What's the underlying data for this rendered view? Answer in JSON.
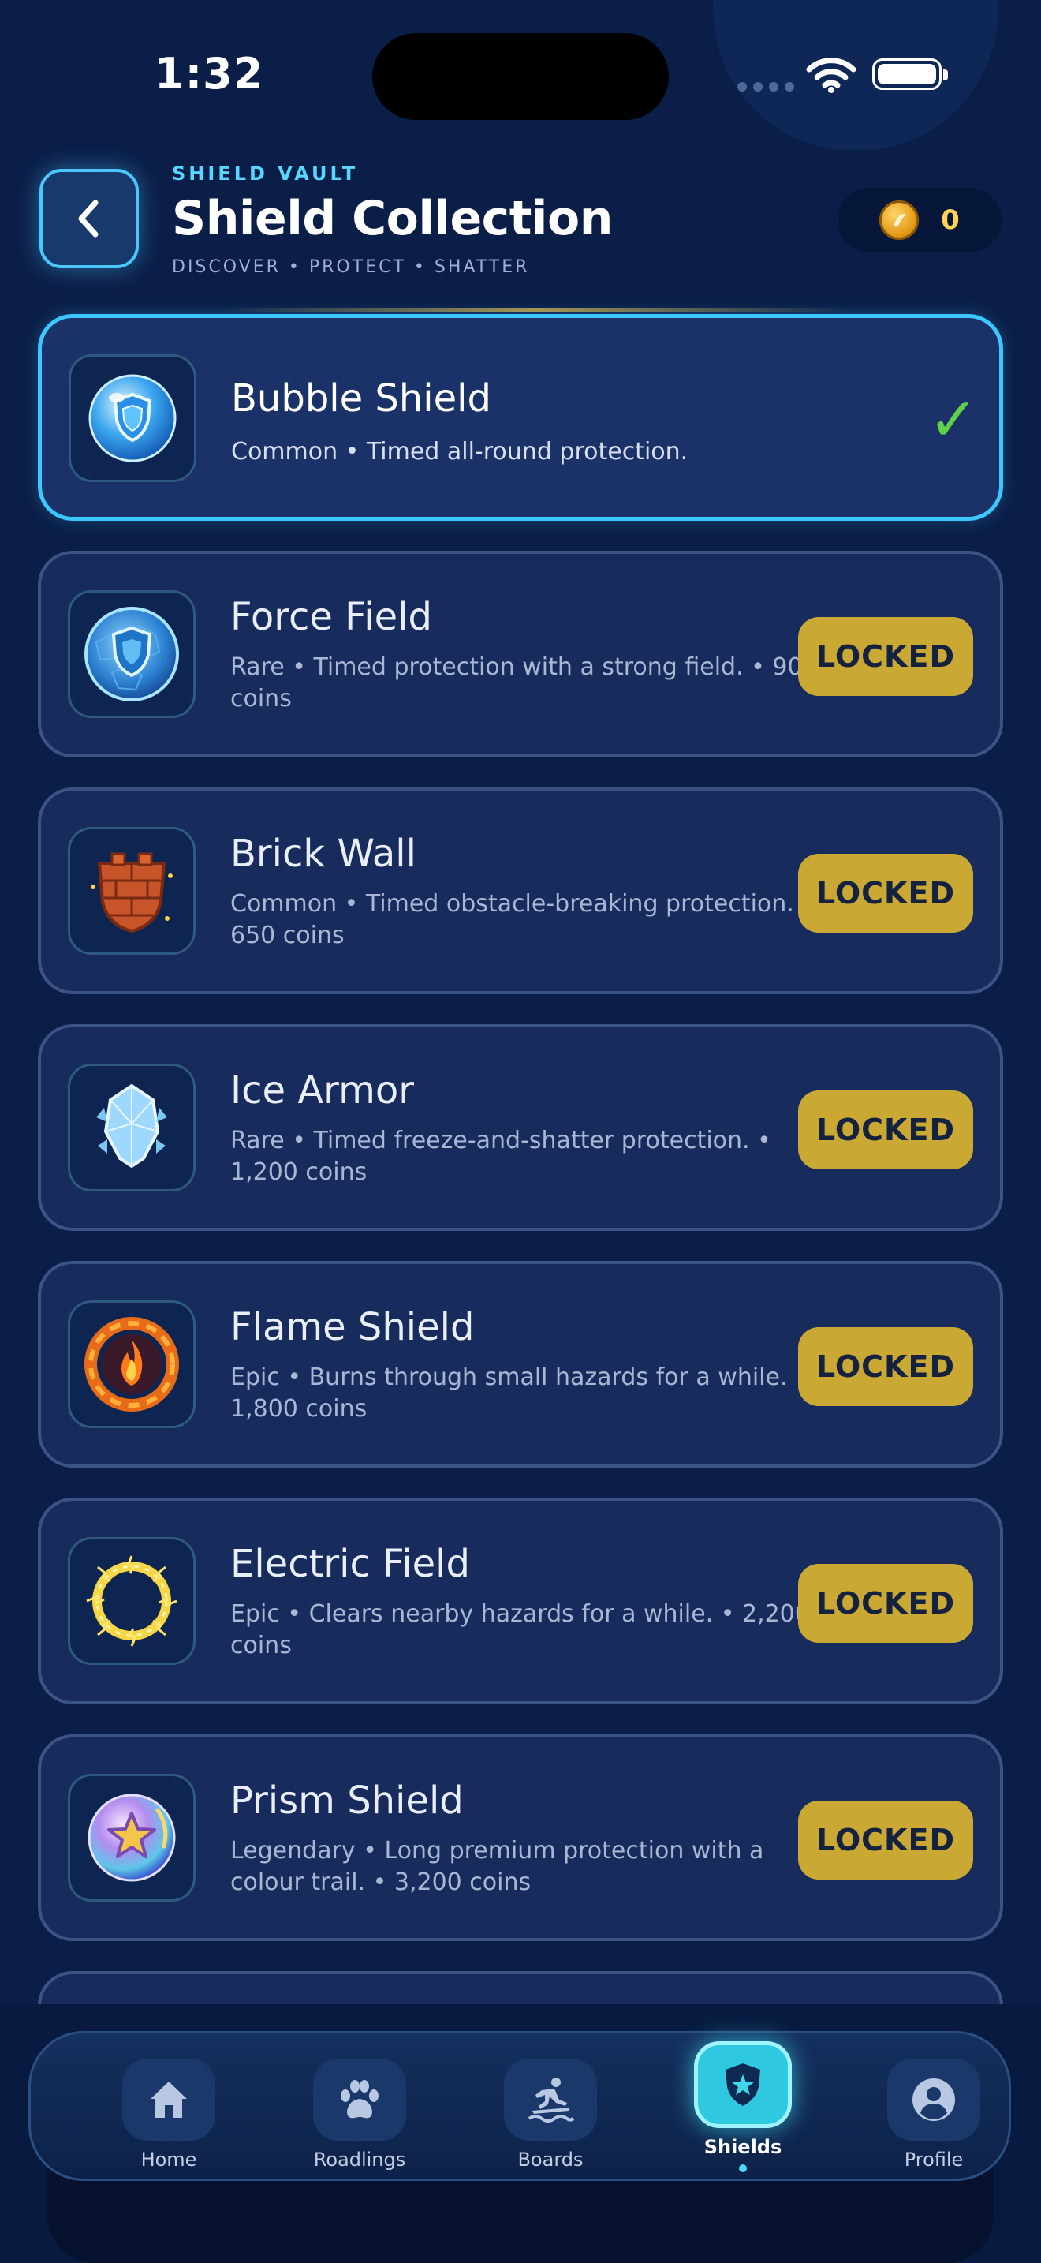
{
  "status_bar": {
    "time": "1:32"
  },
  "header": {
    "eyebrow": "SHIELD VAULT",
    "title": "Shield Collection",
    "tagline": "DISCOVER • PROTECT • SHATTER",
    "coin_count": "0"
  },
  "shields": [
    {
      "name": "Bubble Shield",
      "desc": "Common • Timed all-round protection.",
      "state": "equipped",
      "icon": "bubble-shield-icon"
    },
    {
      "name": "Force Field",
      "desc": "Rare • Timed protection with a strong field. • 900 coins",
      "state": "LOCKED",
      "icon": "force-field-icon"
    },
    {
      "name": "Brick Wall",
      "desc": "Common • Timed obstacle-breaking protection. • 650 coins",
      "state": "LOCKED",
      "icon": "brick-wall-icon"
    },
    {
      "name": "Ice Armor",
      "desc": "Rare • Timed freeze-and-shatter protection. • 1,200 coins",
      "state": "LOCKED",
      "icon": "ice-armor-icon"
    },
    {
      "name": "Flame Shield",
      "desc": "Epic • Burns through small hazards for a while. • 1,800 coins",
      "state": "LOCKED",
      "icon": "flame-shield-icon"
    },
    {
      "name": "Electric Field",
      "desc": "Epic • Clears nearby hazards for a while. • 2,200 coins",
      "state": "LOCKED",
      "icon": "electric-field-icon"
    },
    {
      "name": "Prism Shield",
      "desc": "Legendary • Long premium protection with a colour trail. • 3,200 coins",
      "state": "LOCKED",
      "icon": "prism-shield-icon"
    }
  ],
  "nav": {
    "items": [
      {
        "label": "Home",
        "icon": "home-icon"
      },
      {
        "label": "Roadlings",
        "icon": "paw-icon"
      },
      {
        "label": "Boards",
        "icon": "surfer-icon"
      },
      {
        "label": "Shields",
        "icon": "shield-star-icon",
        "active": true
      },
      {
        "label": "Profile",
        "icon": "profile-icon"
      }
    ]
  },
  "colors": {
    "background": "#0b1e47",
    "accent": "#3cc7ff",
    "locked_button": "#c9a834",
    "check": "#5fd24a",
    "coin_text": "#ffd35a"
  }
}
